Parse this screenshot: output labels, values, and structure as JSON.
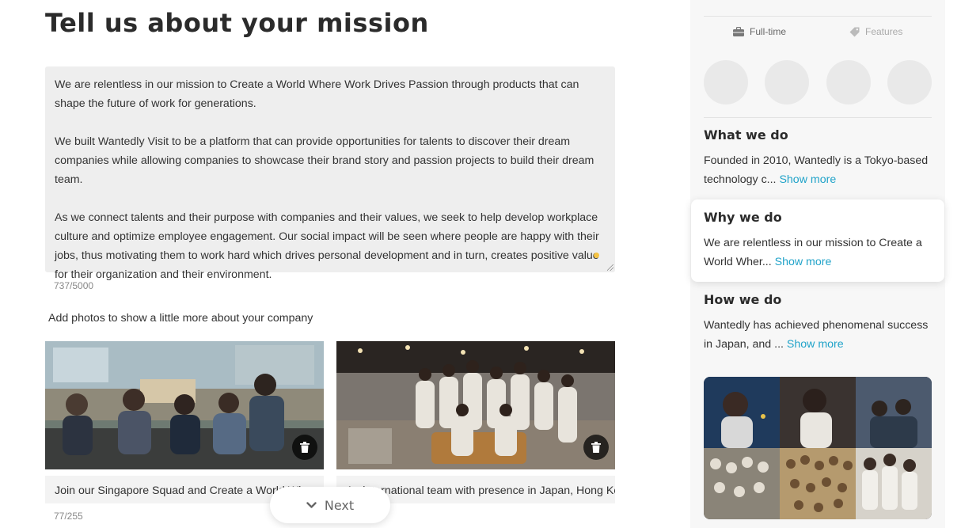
{
  "main": {
    "title": "Tell us about your mission",
    "mission_paragraphs": [
      "We are relentless in our mission to Create a World Where Work Drives Passion through products that can shape the future of work for generations.",
      "We built Wantedly Visit to be a platform that can provide opportunities for talents to discover their dream companies while allowing companies to showcase their brand story and passion projects to build their dream team.",
      "As we connect talents and their purpose with companies and their values, we seek to help develop workplace culture and optimize employee engagement. Our social impact will be seen where people are happy with their jobs, thus motivating them to work hard which drives personal development and in turn, creates positive value for their organization and their environment."
    ],
    "char_count": "737/5000",
    "photos_label": "Add photos to show a little more about your company",
    "photos": [
      {
        "caption": "Join our Singapore Squad and Create a World Where Work Drives Passion"
      },
      {
        "caption": "An international team with presence in Japan, Hong Kong"
      }
    ],
    "caption_count": "77/255",
    "next_label": "Next"
  },
  "preview": {
    "meta": {
      "employment": "Full-time",
      "features": "Features"
    },
    "what": {
      "title": "What we do",
      "text": "Founded in 2010, Wantedly is a Tokyo-based technology c...",
      "show_more": "Show more"
    },
    "why": {
      "title": "Why we do",
      "text": "We are relentless in our mission to Create a World Wher...",
      "show_more": "Show more"
    },
    "how": {
      "title": "How we do",
      "text": "Wantedly has achieved phenomenal success in Japan, and ...",
      "show_more": "Show more"
    }
  },
  "colors": {
    "link": "#21a3c9",
    "textarea_bg": "#eeeeee",
    "panel_bg": "#f7f7f7",
    "status_dot": "#f5c344"
  },
  "icons": [
    "trash-icon",
    "chevron-down-icon",
    "briefcase-icon",
    "tag-icon"
  ]
}
